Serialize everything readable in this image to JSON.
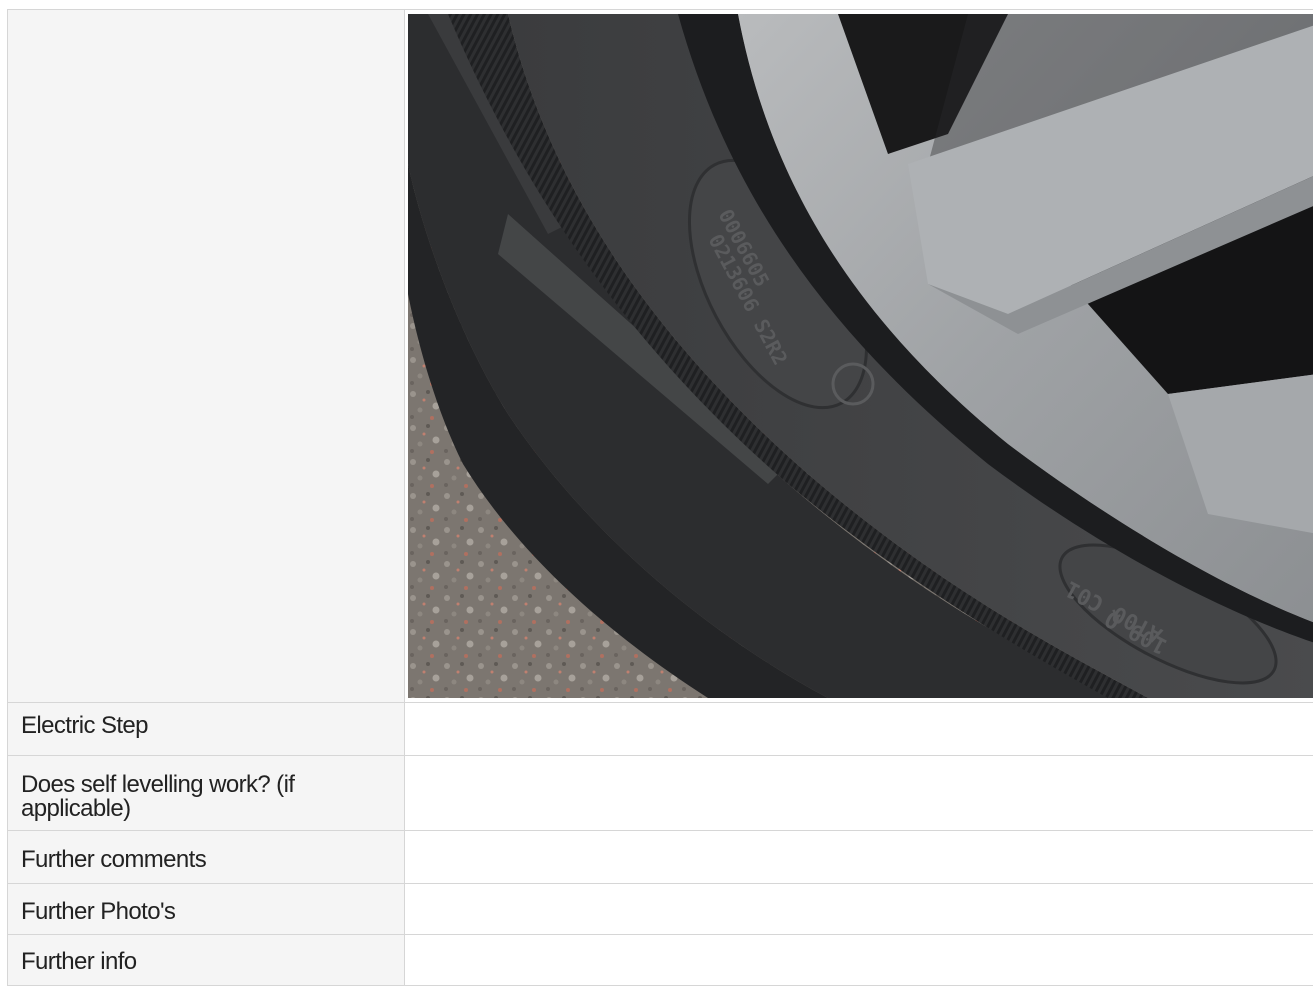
{
  "rows": [
    {
      "label": "",
      "value": ""
    },
    {
      "label": "Electric Step",
      "value": ""
    },
    {
      "label": "Does self levelling work? (if applicable)",
      "value": ""
    },
    {
      "label": "Further comments",
      "value": ""
    },
    {
      "label": "Further Photo's",
      "value": ""
    },
    {
      "label": "Further info",
      "value": ""
    }
  ],
  "photo": {
    "subject": "tyre-sidewall-photo",
    "embossed_text": [
      "0006605",
      "0213606 S2R2",
      "109 Q",
      "AT00 C01"
    ]
  }
}
